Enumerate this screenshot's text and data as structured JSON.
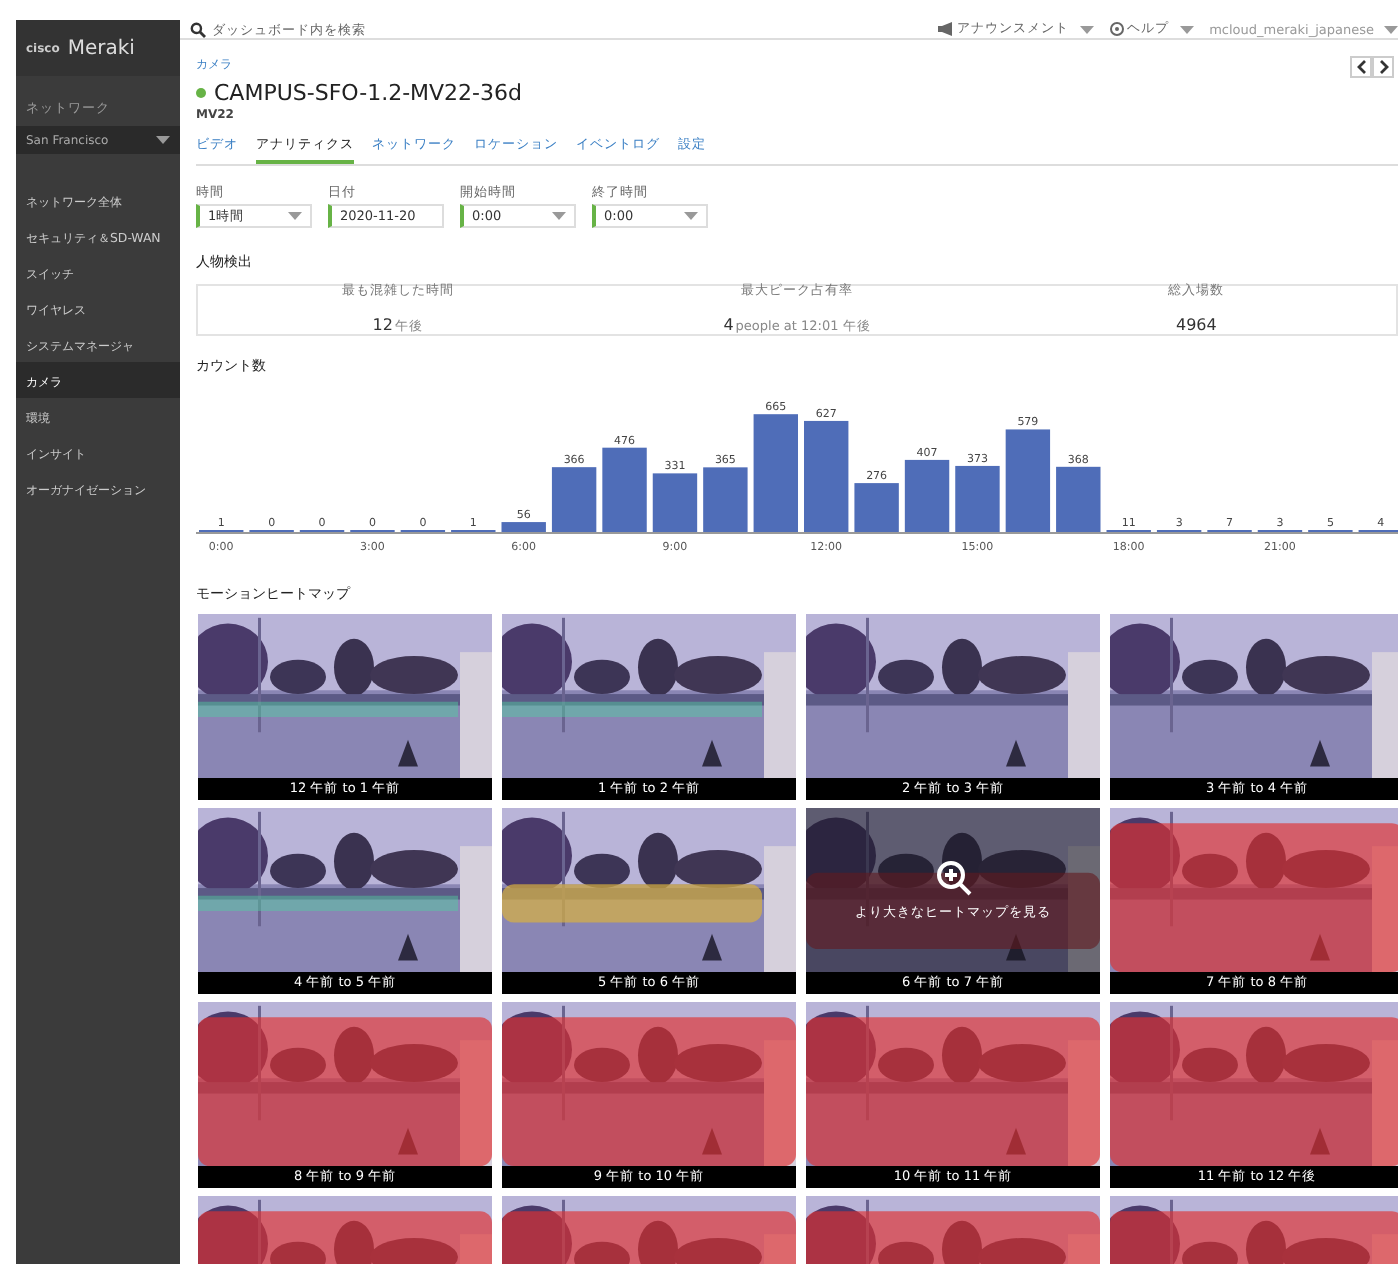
{
  "sidebar": {
    "logo_mark": "cisco",
    "logo_text": "Meraki",
    "network_label": "ネットワーク",
    "network": "San Francisco",
    "items": [
      {
        "label": "ネットワーク全体",
        "selected": false
      },
      {
        "label": "セキュリティ＆SD-WAN",
        "selected": false
      },
      {
        "label": "スイッチ",
        "selected": false
      },
      {
        "label": "ワイヤレス",
        "selected": false
      },
      {
        "label": "システムマネージャ",
        "selected": false
      },
      {
        "label": "カメラ",
        "selected": true
      },
      {
        "label": "環境",
        "selected": false
      },
      {
        "label": "インサイト",
        "selected": false
      },
      {
        "label": "オーガナイゼーション",
        "selected": false
      }
    ]
  },
  "topbar": {
    "search": {
      "placeholder": "ダッシュボード内を検索"
    },
    "menus": [
      {
        "kind": "announce",
        "label": "アナウンスメント"
      },
      {
        "kind": "help",
        "label": "ヘルプ"
      },
      {
        "kind": "user",
        "label": "mcloud_meraki_japanese"
      }
    ]
  },
  "breadcrumb": "カメラ",
  "device": {
    "title": "CAMPUS-SFO-1.2-MV22-36d",
    "online": true,
    "model": "MV22"
  },
  "tabs": [
    {
      "label": "ビデオ",
      "selected": false
    },
    {
      "label": "アナリティクス",
      "selected": true
    },
    {
      "label": "ネットワーク",
      "selected": false
    },
    {
      "label": "ロケーション",
      "selected": false
    },
    {
      "label": "イベントログ",
      "selected": false
    },
    {
      "label": "設定",
      "selected": false
    }
  ],
  "filters": [
    {
      "label": "時間",
      "value": "1時間",
      "dropdown": true
    },
    {
      "label": "日付",
      "value": "2020-11-20",
      "dropdown": false
    },
    {
      "label": "開始時間",
      "value": "0:00",
      "dropdown": true
    },
    {
      "label": "終了時間",
      "value": "0:00",
      "dropdown": true
    }
  ],
  "people_detection": {
    "title": "人物検出",
    "stats": [
      {
        "label": "最も混雑した時間",
        "value": "12",
        "unit": "午後"
      },
      {
        "label": "最大ピーク占有率",
        "value": "4",
        "unit": "people at 12:01 午後"
      },
      {
        "label": "総入場数",
        "value": "4964"
      }
    ]
  },
  "count": {
    "title": "カウント数",
    "chart_data": {
      "type": "bar",
      "x": [
        0,
        1,
        2,
        3,
        4,
        5,
        6,
        7,
        8,
        9,
        10,
        11,
        12,
        13,
        14,
        15,
        16,
        17,
        18,
        19,
        20,
        21,
        22,
        23
      ],
      "xlim": [
        -0.5,
        23.5
      ],
      "series": [
        {
          "color": "#4f6db8",
          "values": [
            1,
            0,
            0,
            0,
            0,
            1,
            56,
            366,
            476,
            331,
            365,
            665,
            627,
            276,
            407,
            373,
            579,
            368,
            11,
            3,
            7,
            3,
            5,
            4
          ]
        }
      ],
      "xticks": [
        {
          "value": 0,
          "label": "0:00"
        },
        {
          "value": 3,
          "label": "3:00"
        },
        {
          "value": 6,
          "label": "6:00"
        },
        {
          "value": 9,
          "label": "9:00"
        },
        {
          "value": 12,
          "label": "12:00"
        },
        {
          "value": 15,
          "label": "15:00"
        },
        {
          "value": 18,
          "label": "18:00"
        },
        {
          "value": 21,
          "label": "21:00"
        }
      ],
      "data_labels": true
    }
  },
  "heatmap": {
    "title": "モーションヒートマップ",
    "hover_text": "より大きなヒートマップを見る",
    "tiles": [
      {
        "kind": "captioned",
        "label": "12 午前 to 1 午前",
        "hovered": false
      },
      {
        "kind": "captioned",
        "label": "1 午前 to 2 午前",
        "hovered": false
      },
      {
        "kind": "captioned",
        "label": "2 午前 to 3 午前",
        "hovered": false
      },
      {
        "kind": "captioned",
        "label": "3 午前 to 4 午前",
        "hovered": false
      },
      {
        "kind": "captioned",
        "label": "4 午前 to 5 午前",
        "hovered": false
      },
      {
        "kind": "captioned",
        "label": "5 午前 to 6 午前",
        "hovered": false
      },
      {
        "kind": "captioned",
        "label": "6 午前 to 7 午前",
        "hovered": true
      },
      {
        "kind": "captioned",
        "label": "7 午前 to 8 午前",
        "hovered": false
      },
      {
        "kind": "captioned",
        "label": "8 午前 to 9 午前",
        "hovered": false
      },
      {
        "kind": "captioned",
        "label": "9 午前 to 10 午前",
        "hovered": false
      },
      {
        "kind": "captioned",
        "label": "10 午前 to 11 午前",
        "hovered": false
      },
      {
        "kind": "captioned",
        "label": "11 午前 to 12 午後",
        "hovered": false
      },
      {
        "kind": "picture"
      },
      {
        "kind": "picture"
      },
      {
        "kind": "picture"
      },
      {
        "kind": "picture"
      }
    ]
  }
}
